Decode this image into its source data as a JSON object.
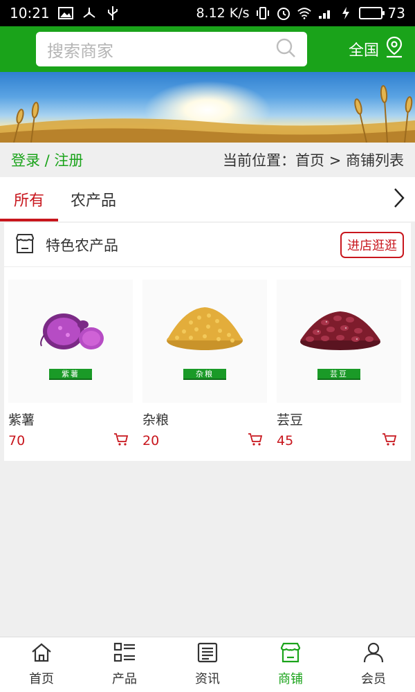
{
  "status_bar": {
    "time": "10:21",
    "net_speed": "8.12 K/s",
    "battery": "73",
    "battery_level": 0.73
  },
  "search": {
    "placeholder": "搜索商家"
  },
  "region": {
    "label": "全国"
  },
  "breadcrumb": {
    "login": "登录 / 注册",
    "location": "当前位置：首页 > 商铺列表"
  },
  "tabs": [
    {
      "label": "所有",
      "active": true
    },
    {
      "label": "农产品",
      "active": false
    }
  ],
  "shop": {
    "name": "特色农产品",
    "enter_label": "进店逛逛",
    "products": [
      {
        "name": "紫薯",
        "tag": "紫薯",
        "price": "70"
      },
      {
        "name": "杂粮",
        "tag": "杂粮",
        "price": "20"
      },
      {
        "name": "芸豆",
        "tag": "芸豆",
        "price": "45"
      }
    ]
  },
  "bottom_nav": [
    {
      "label": "首页",
      "icon": "home-icon",
      "active": false
    },
    {
      "label": "产品",
      "icon": "list-icon",
      "active": false
    },
    {
      "label": "资讯",
      "icon": "news-icon",
      "active": false
    },
    {
      "label": "商铺",
      "icon": "store-icon",
      "active": true
    },
    {
      "label": "会员",
      "icon": "user-icon",
      "active": false
    }
  ],
  "colors": {
    "brand_green": "#1aa31a",
    "accent_red": "#c8161d"
  }
}
